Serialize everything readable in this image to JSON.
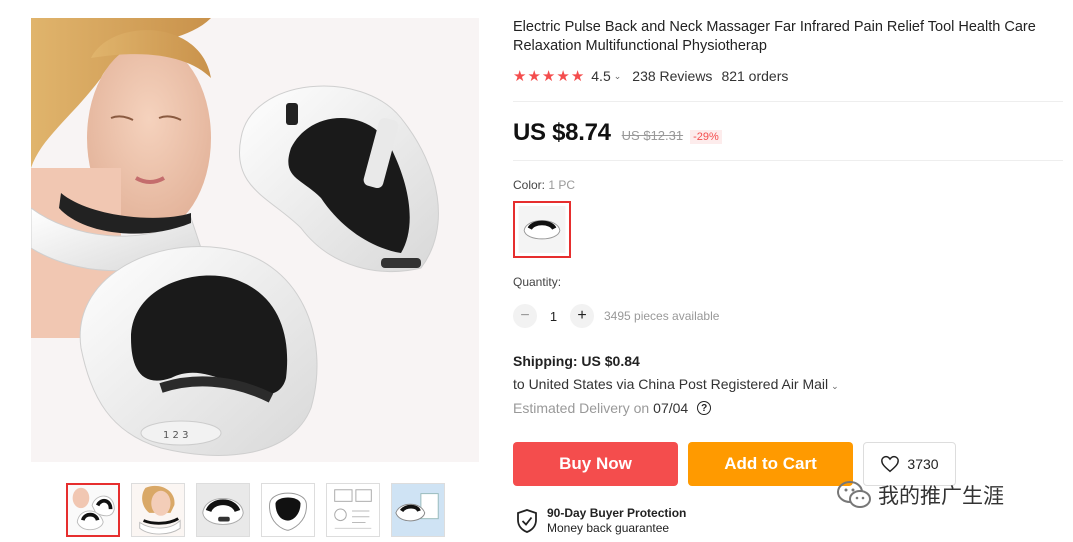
{
  "product": {
    "title": "Electric Pulse Back and Neck Massager Far Infrared Pain Relief Tool Health Care Relaxation Multifunctional Physiotherap",
    "rating": "4.5",
    "reviews": "238 Reviews",
    "orders": "821 orders",
    "star_color": "#f44d4d"
  },
  "price": {
    "current": "US $8.74",
    "original": "US $12.31",
    "discount": "-29%"
  },
  "color": {
    "label": "Color:",
    "selected": "1 PC"
  },
  "quantity": {
    "label": "Quantity:",
    "value": "1",
    "minus": "−",
    "plus": "+",
    "available": "3495 pieces available"
  },
  "shipping": {
    "title": "Shipping: US $0.84",
    "route": "to United States via China Post Registered Air Mail",
    "delivery_label": "Estimated Delivery on",
    "delivery_date": "07/04",
    "help": "?"
  },
  "actions": {
    "buy_now": "Buy Now",
    "add_to_cart": "Add to Cart",
    "wishlist_count": "3730",
    "buy_color": "#f44d4d",
    "cart_color": "#ff9a00"
  },
  "protection": {
    "title": "90-Day Buyer Protection",
    "subtitle": "Money back guarantee"
  },
  "watermark": {
    "text": "我的推广生涯"
  },
  "thumbnails": [
    {
      "icon": "neck-massager-pair-thumbnail"
    },
    {
      "icon": "model-wearing-massager-thumbnail"
    },
    {
      "icon": "massager-front-thumbnail"
    },
    {
      "icon": "massager-black-white-thumbnail"
    },
    {
      "icon": "accessories-diagram-thumbnail"
    },
    {
      "icon": "massager-blue-background-thumbnail"
    }
  ]
}
